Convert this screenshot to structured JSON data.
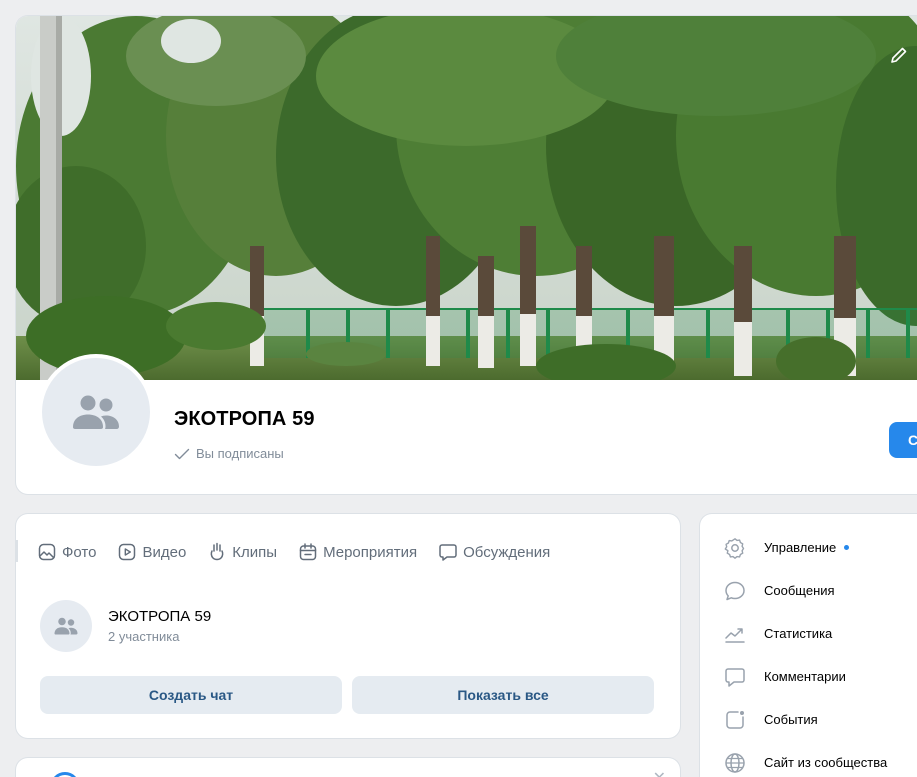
{
  "group": {
    "name": "ЭКОТРОПА 59",
    "subscription_status": "Вы подписаны",
    "cta_label": "С"
  },
  "tabs": [
    {
      "label": "Фото",
      "icon": "photo-icon"
    },
    {
      "label": "Видео",
      "icon": "video-icon"
    },
    {
      "label": "Клипы",
      "icon": "clips-icon"
    },
    {
      "label": "Мероприятия",
      "icon": "events-icon"
    },
    {
      "label": "Обсуждения",
      "icon": "discussions-icon"
    }
  ],
  "chat": {
    "title": "ЭКОТРОПА 59",
    "members": "2 участника",
    "create_label": "Создать чат",
    "show_all_label": "Показать все"
  },
  "menu": {
    "items": [
      {
        "label": "Управление",
        "icon": "gear-icon",
        "has_dot": true
      },
      {
        "label": "Сообщения",
        "icon": "message-icon"
      },
      {
        "label": "Статистика",
        "icon": "stats-icon"
      },
      {
        "label": "Комментарии",
        "icon": "comment-icon"
      },
      {
        "label": "События",
        "icon": "event-icon"
      },
      {
        "label": "Сайт из сообщества",
        "icon": "globe-icon"
      }
    ]
  },
  "colors": {
    "accent": "#2688eb",
    "page_bg": "#edeef0",
    "secondary_btn_bg": "#e5ebf1",
    "secondary_btn_text": "#2a5885",
    "muted_text": "#818c99"
  }
}
